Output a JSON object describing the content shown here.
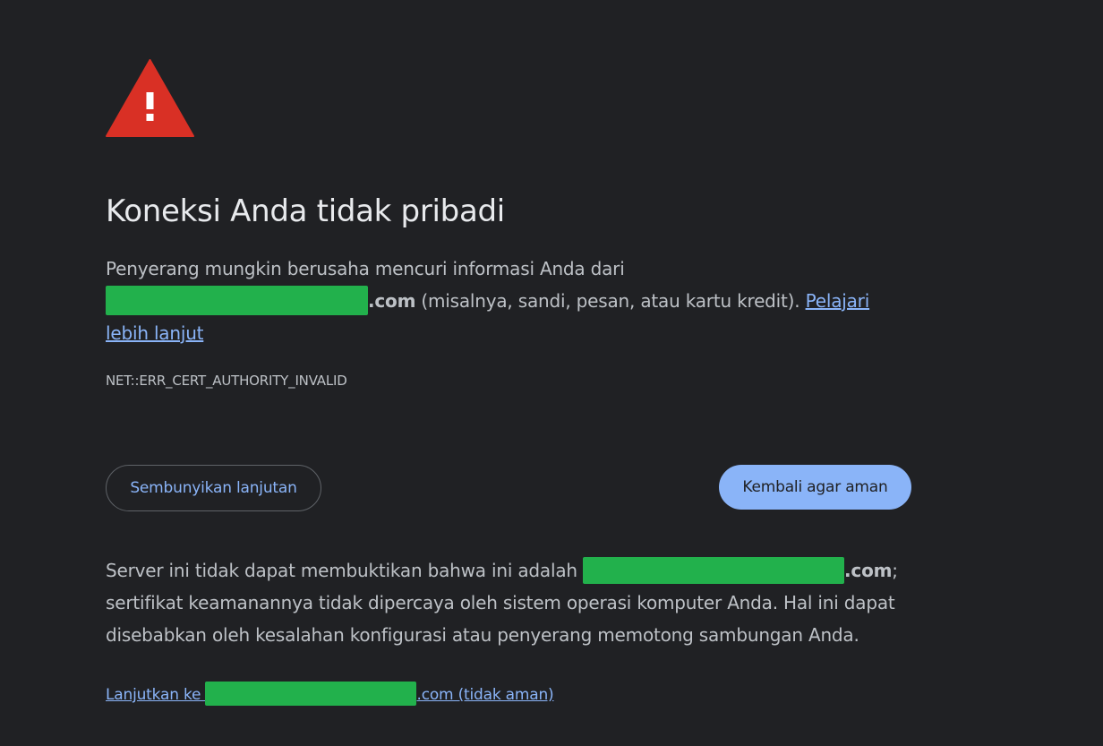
{
  "icon": "warning-triangle-icon",
  "colors": {
    "background": "#202124",
    "heading": "#e8eaed",
    "body_text": "#bdc1c6",
    "link": "#8ab4f8",
    "warning_icon": "#d93025",
    "redaction": "#22b14c"
  },
  "heading": "Koneksi Anda tidak pribadi",
  "main_message": {
    "line1": "Penyerang mungkin berusaha mencuri informasi Anda dari",
    "domain_suffix": ".com",
    "after_domain": " (misalnya, sandi, pesan, atau kartu kredit). ",
    "learn_more": "Pelajari lebih lanjut"
  },
  "error_code": "NET::ERR_CERT_AUTHORITY_INVALID",
  "buttons": {
    "hide_advanced": "Sembunyikan lanjutan",
    "back_to_safety": "Kembali agar aman"
  },
  "details": {
    "before_domain": "Server ini tidak dapat membuktikan bahwa ini adalah ",
    "domain_suffix": ".com",
    "after_domain": "; sertifikat keamanannya tidak dipercaya oleh sistem operasi komputer Anda. Hal ini dapat disebabkan oleh kesalahan konfigurasi atau penyerang memotong sambungan Anda."
  },
  "proceed_link": {
    "prefix": "Lanjutkan ke ",
    "suffix": ".com (tidak aman)"
  }
}
